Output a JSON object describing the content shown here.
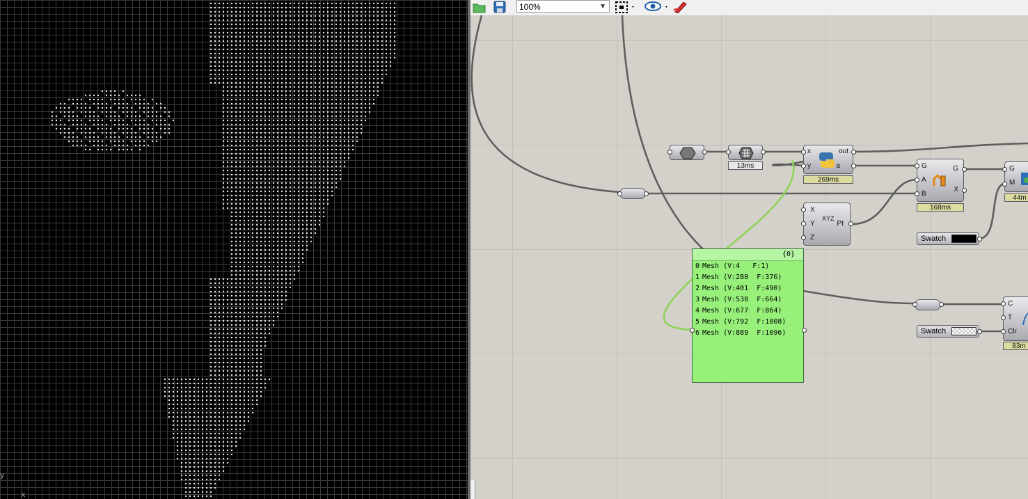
{
  "viewport": {
    "axis_y": "y",
    "axis_x": "x"
  },
  "toolbar": {
    "zoom_value": "100%",
    "icons": [
      "open-file-icon",
      "save-icon",
      "zoom-select-icon",
      "preview-eye-icon",
      "sketch-pen-icon"
    ]
  },
  "components": {
    "hex_param": {
      "icon": "hexagon-icon"
    },
    "mesh_param": {
      "icon": "mesh-icon",
      "timer": "13ms"
    },
    "python": {
      "inputs": [
        "x",
        "y"
      ],
      "outputs": [
        "out",
        "a"
      ],
      "timer": "269ms",
      "icon": "python-icon"
    },
    "weave": {
      "inputs": [
        "G",
        "A",
        "B"
      ],
      "outputs": [
        "G",
        "X"
      ],
      "timer": "168ms",
      "icon": "dispatch-icon"
    },
    "construct_point": {
      "inputs": [
        "X",
        "Y",
        "Z"
      ],
      "outputs": [
        "Pt"
      ],
      "icon_text": "XYZ"
    },
    "preview_top": {
      "inputs": [
        "G",
        "M"
      ],
      "timer": "44m"
    },
    "preview_bottom": {
      "inputs": [
        "C",
        "T",
        "Clr"
      ],
      "timer": "83m"
    },
    "swatch_black": {
      "label": "Swatch",
      "color": "#000000"
    },
    "swatch_trans": {
      "label": "Swatch",
      "color": "transparent"
    }
  },
  "panel": {
    "path": "{0}",
    "rows": [
      {
        "index": "0",
        "text": "Mesh (V:4   F:1)"
      },
      {
        "index": "1",
        "text": "Mesh (V:280  F:376)"
      },
      {
        "index": "2",
        "text": "Mesh (V:401  F:490)"
      },
      {
        "index": "3",
        "text": "Mesh (V:530  F:664)"
      },
      {
        "index": "4",
        "text": "Mesh (V:677  F:864)"
      },
      {
        "index": "5",
        "text": "Mesh (V:792  F:1008)"
      },
      {
        "index": "6",
        "text": "Mesh (V:889  F:1096)"
      }
    ]
  },
  "colors": {
    "canvas": "#d4d1ca",
    "panel": "#96f07a",
    "wire": "#5e5e5e",
    "wire_selected": "#8ed35a",
    "viewport_bg": "#000000",
    "dots": "#e6e6e6"
  }
}
